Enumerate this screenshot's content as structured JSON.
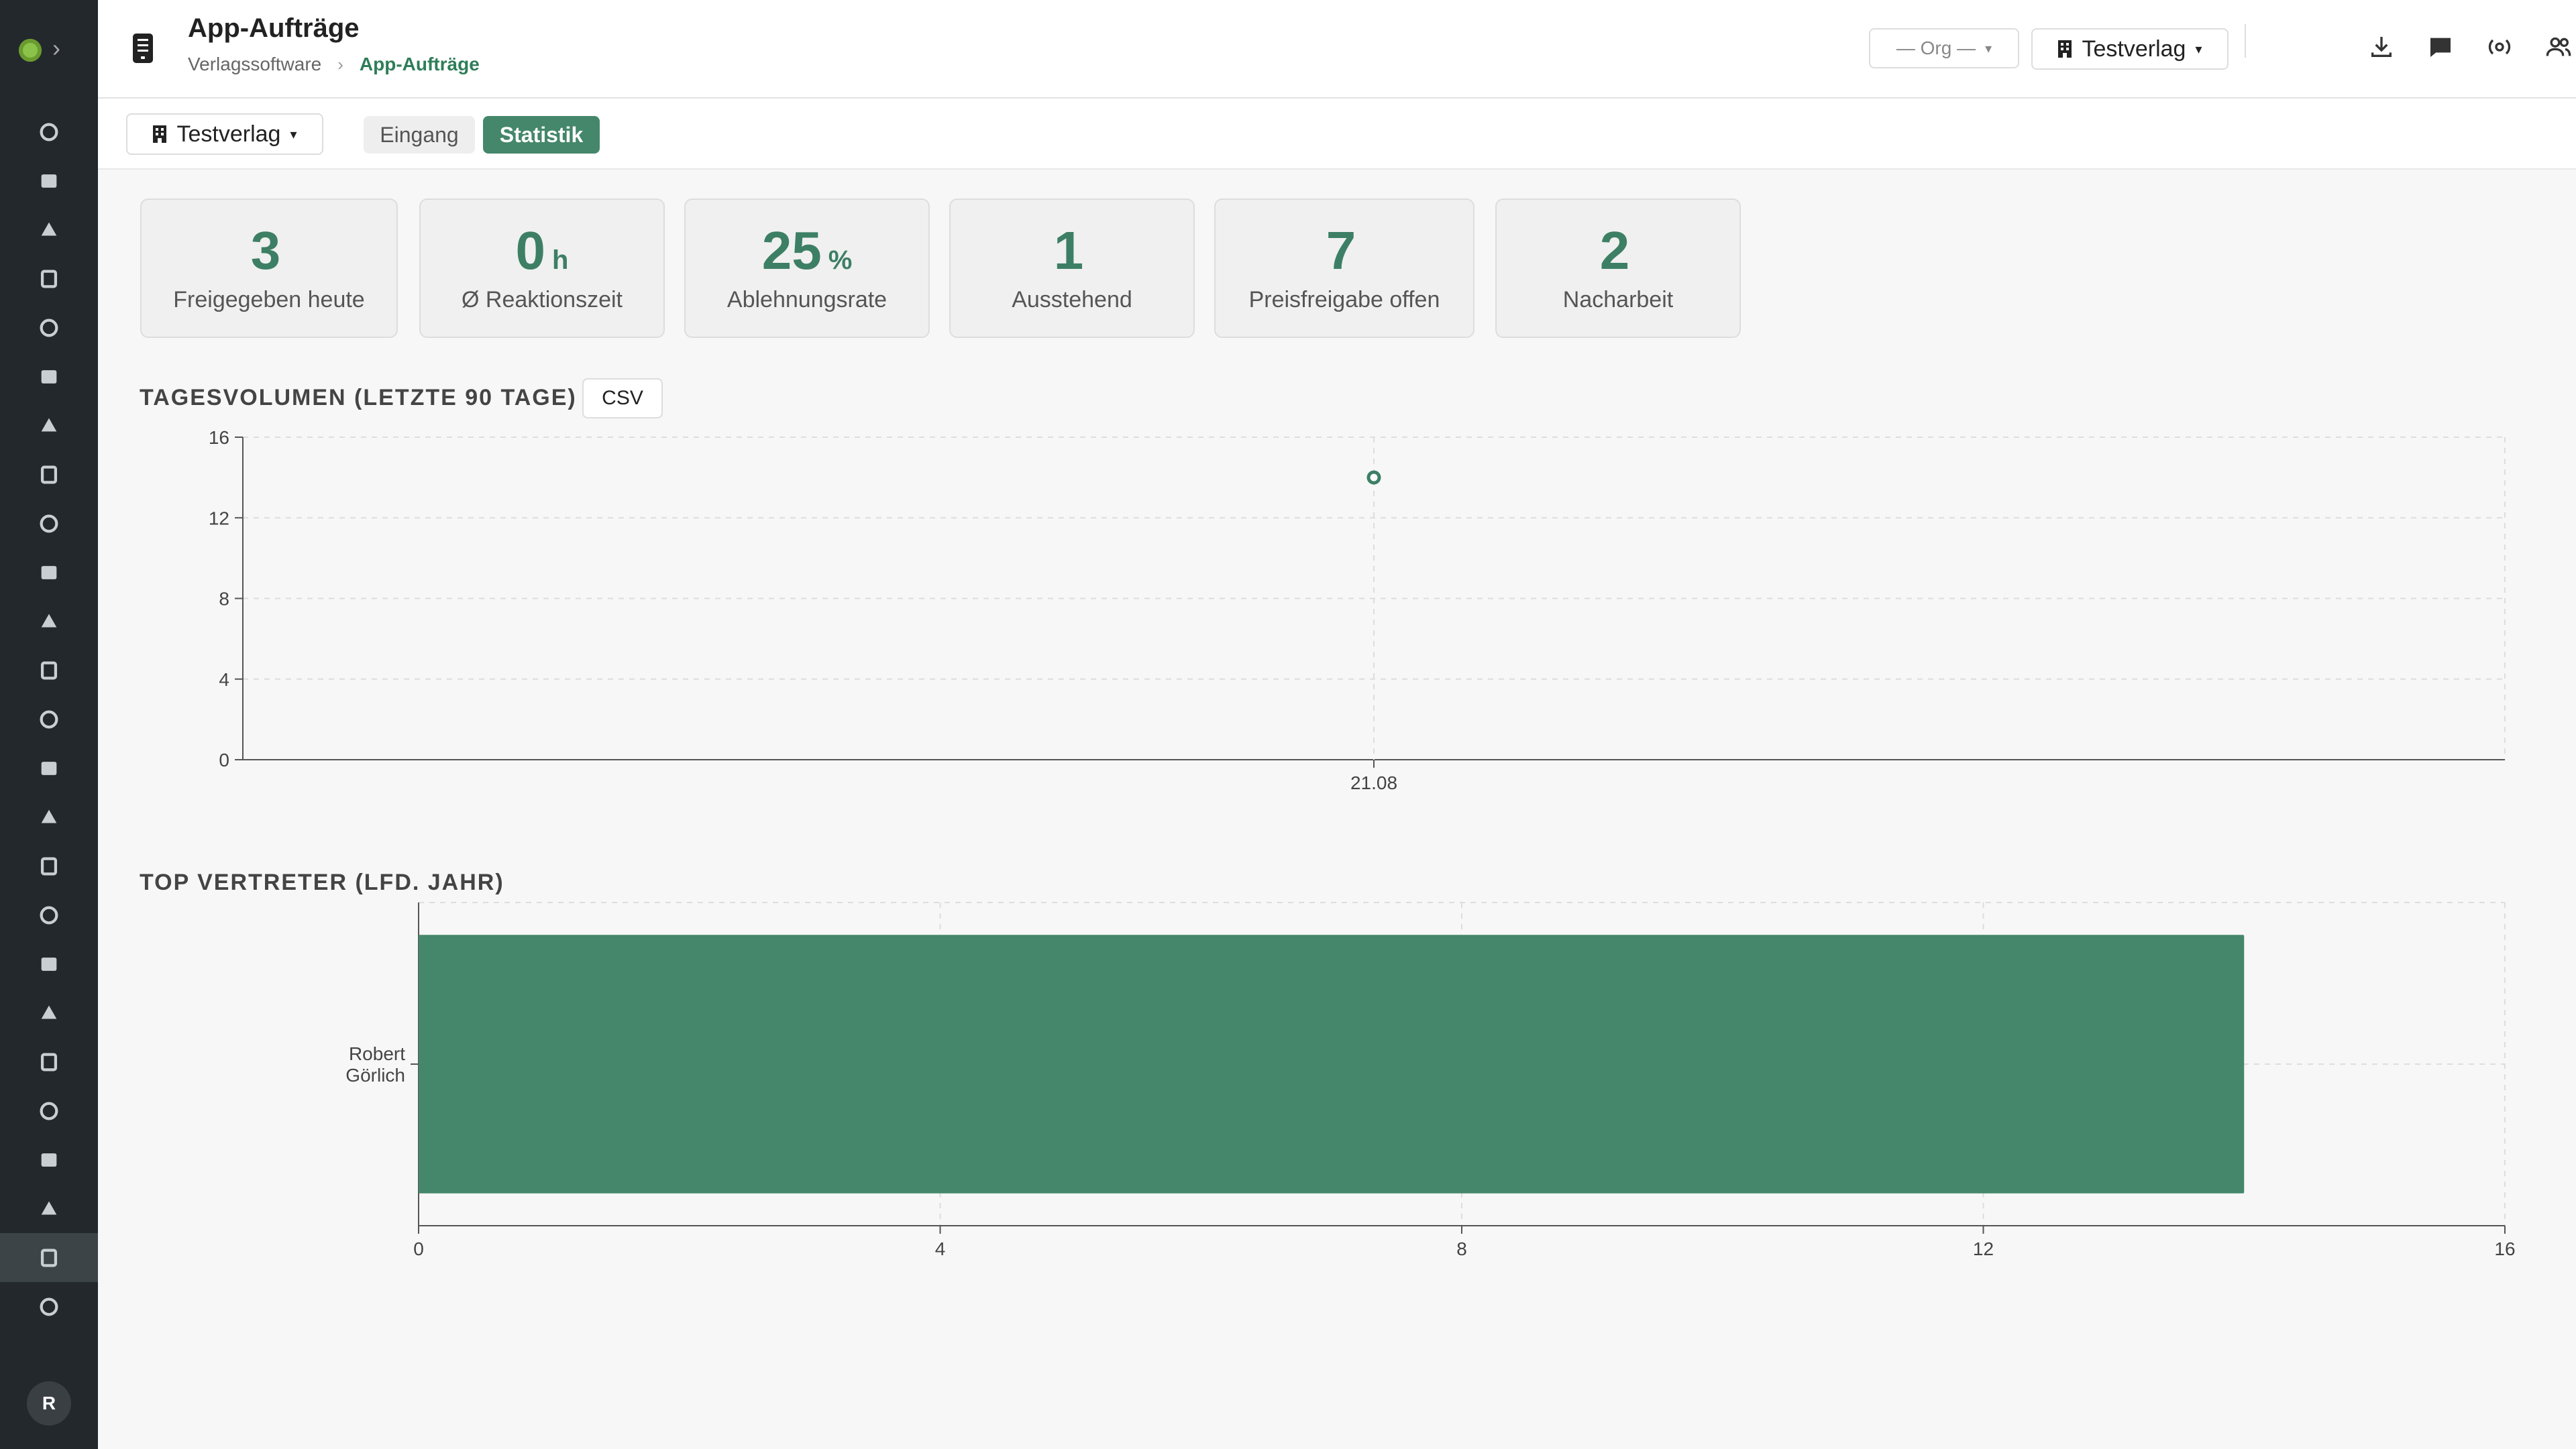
{
  "header": {
    "title": "App-Aufträge",
    "breadcrumb": [
      "Verlagssoftware",
      "App-Aufträge"
    ],
    "org_select": "— Org —",
    "verlag_select": "Testverlag"
  },
  "subbar": {
    "verlag_select": "Testverlag",
    "tabs": [
      "Eingang",
      "Statistik"
    ],
    "active_tab": "Statistik"
  },
  "sidebar": {
    "avatar": "R",
    "icons": [
      "pie-chart-icon",
      "calendar-icon",
      "dashboard-icon",
      "edit-user-icon",
      "mail-stack-icon",
      "send-icon",
      "lightbulb-icon",
      "library-icon",
      "image-icon",
      "briefcase-icon",
      "board-icon",
      "cart-icon",
      "feather-icon",
      "card-icon",
      "circle-icon",
      "bag-icon",
      "megaphone-icon",
      "ticket-icon",
      "music-icon",
      "document-icon",
      "printer-icon",
      "forward-icon",
      "bar-chart-icon",
      "app-orders-icon",
      "shield-icon"
    ],
    "active": "app-orders-icon"
  },
  "kpis": [
    {
      "value": "3",
      "unit": "",
      "label": "Freigegeben heute"
    },
    {
      "value": "0",
      "unit": "h",
      "label": "Ø Reaktionszeit"
    },
    {
      "value": "25",
      "unit": "%",
      "label": "Ablehnungsrate"
    },
    {
      "value": "1",
      "unit": "",
      "label": "Ausstehend"
    },
    {
      "value": "7",
      "unit": "",
      "label": "Preisfreigabe offen"
    },
    {
      "value": "2",
      "unit": "",
      "label": "Nacharbeit"
    }
  ],
  "sections": {
    "daily_title": "TAGESVOLUMEN (LETZTE 90 TAGE)",
    "csv_label": "CSV",
    "top_title": "TOP VERTRETER (LFD. JAHR)"
  },
  "chart_data": [
    {
      "type": "scatter",
      "title": "TAGESVOLUMEN (LETZTE 90 TAGE)",
      "x": [
        "21.08"
      ],
      "y": [
        14
      ],
      "ylim": [
        0,
        16
      ],
      "yticks": [
        0,
        4,
        8,
        12,
        16
      ],
      "grid": true,
      "color": "#3d7f65"
    },
    {
      "type": "bar",
      "orientation": "horizontal",
      "title": "TOP VERTRETER (LFD. JAHR)",
      "categories": [
        "Robert Görlich"
      ],
      "values": [
        14
      ],
      "xlim": [
        0,
        16
      ],
      "xticks": [
        0,
        4,
        8,
        12,
        16
      ],
      "grid": true,
      "color": "#44876a"
    }
  ]
}
